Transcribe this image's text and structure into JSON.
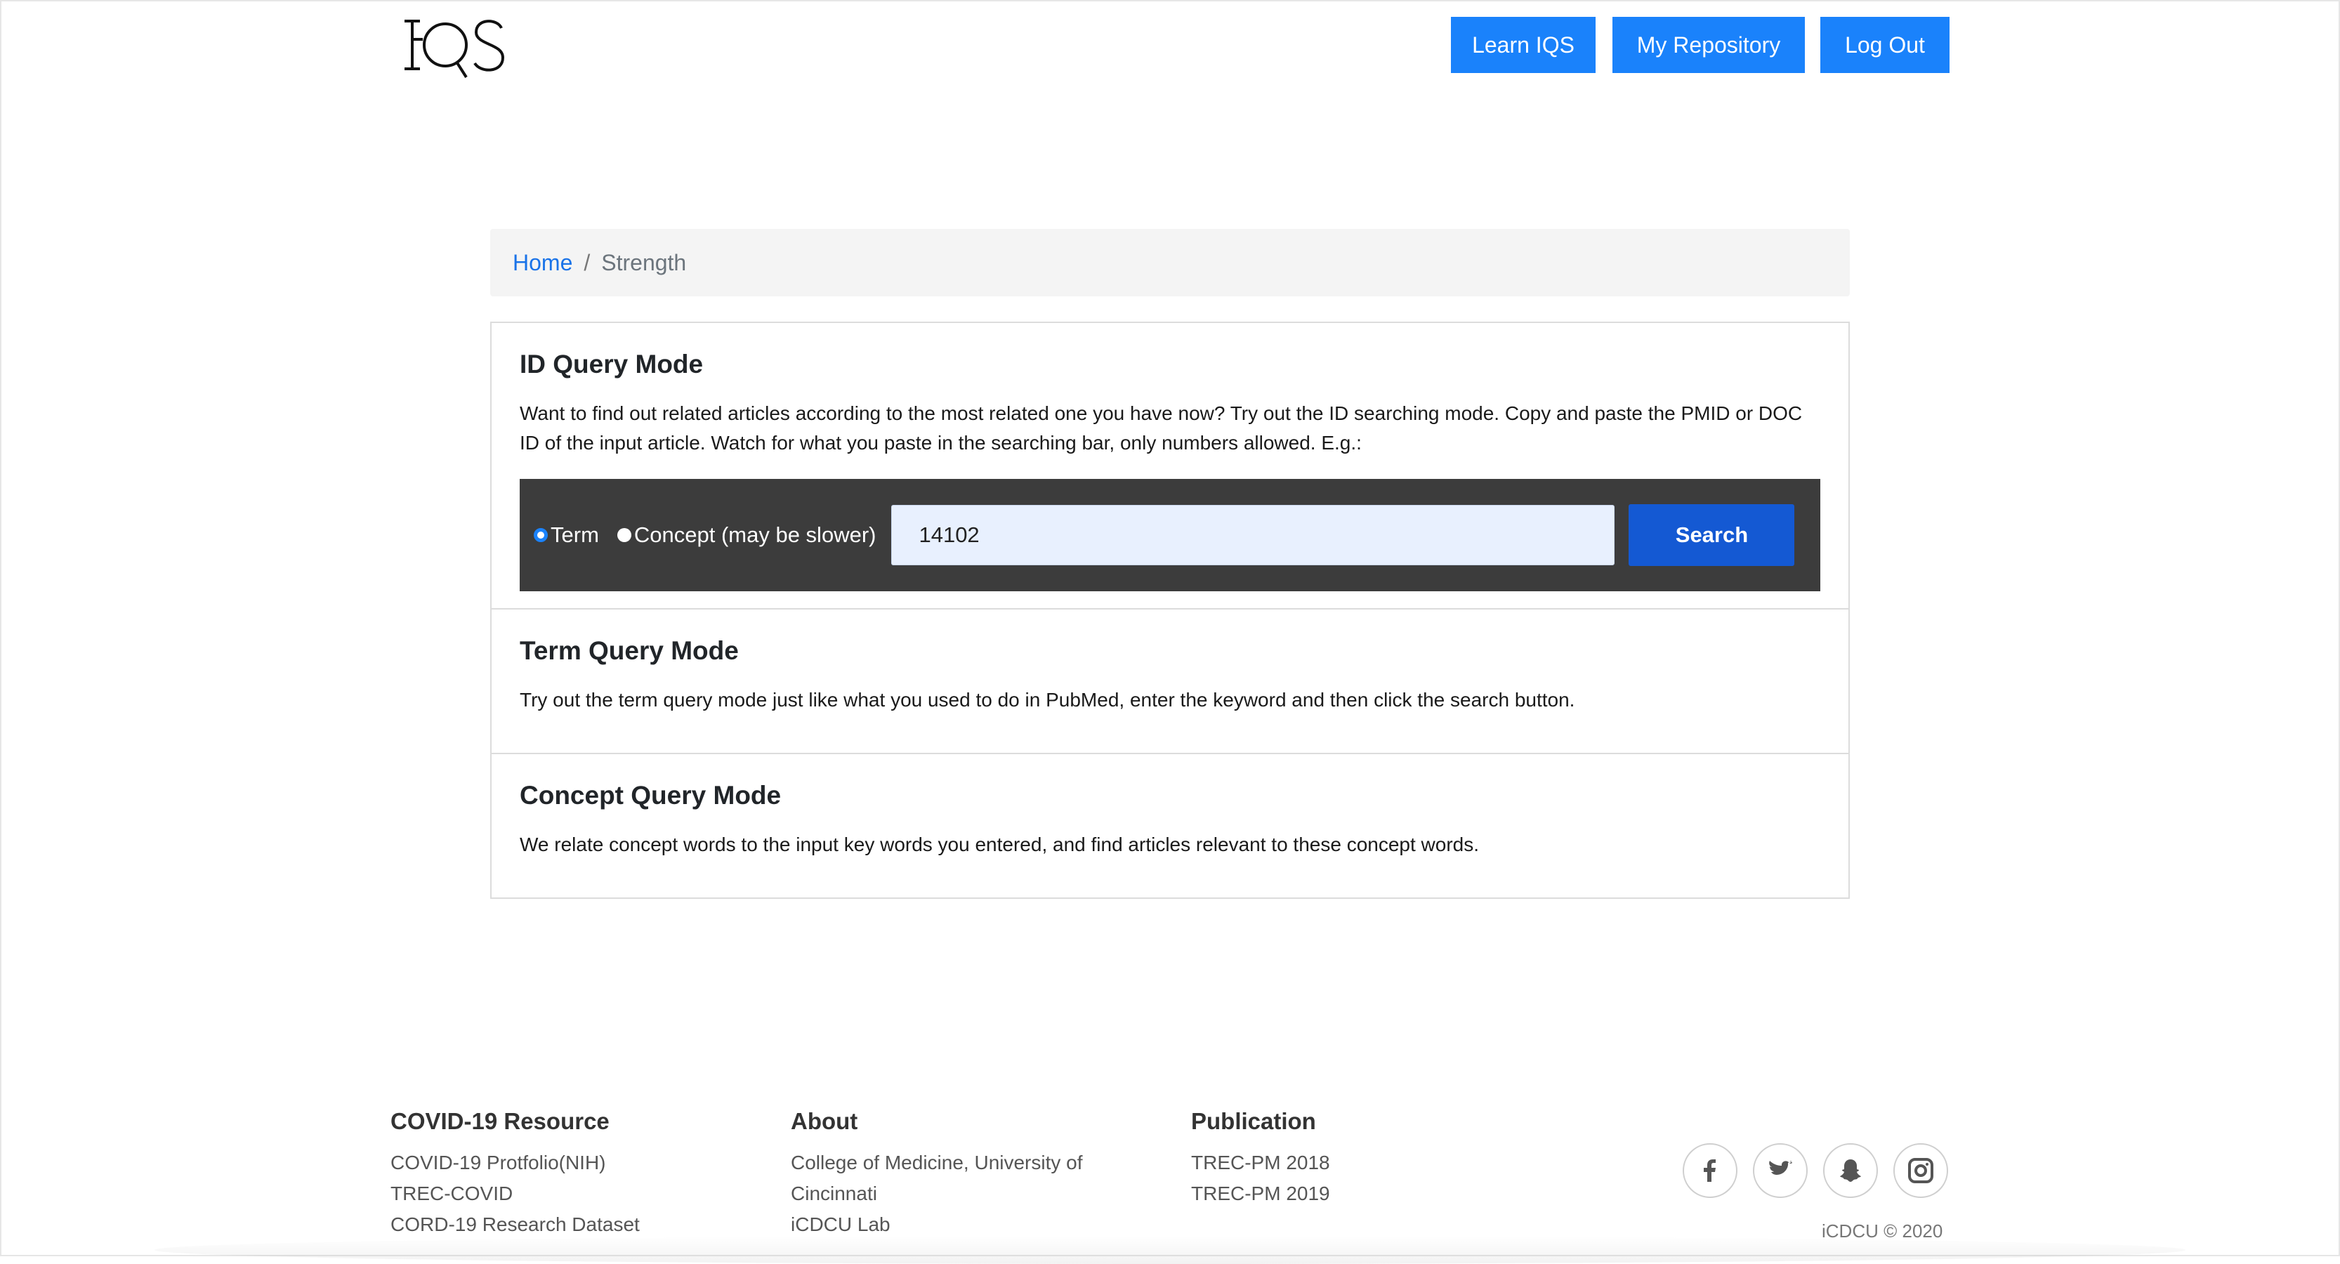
{
  "brand": {
    "logo_text": "IQS"
  },
  "nav": {
    "learn_label": "Learn IQS",
    "repo_label": "My Repository",
    "logout_label": "Log Out"
  },
  "breadcrumb": {
    "home": "Home",
    "separator": "/",
    "current": "Strength"
  },
  "id_mode": {
    "title": "ID Query Mode",
    "description": "Want to find out related articles according to the most related one you have now? Try out the ID searching mode. Copy and paste the PMID or DOC ID of the input article. Watch for what you paste in the searching bar, only numbers allowed. E.g.:",
    "radio_term": "Term",
    "radio_concept": "Concept (may be slower)",
    "selected_radio": "Term",
    "search_value": "14102",
    "search_button": "Search"
  },
  "term_mode": {
    "title": "Term Query Mode",
    "description": "Try out the term query mode just like what you used to do in PubMed, enter the keyword and then click the search button."
  },
  "concept_mode": {
    "title": "Concept Query Mode",
    "description": "We relate concept words to the input key words you entered, and find articles relevant to these concept words."
  },
  "footer": {
    "covid": {
      "title": "COVID-19 Resource",
      "links": [
        "COVID-19 Protfolio(NIH)",
        "TREC-COVID",
        "CORD-19 Research Dataset"
      ]
    },
    "about": {
      "title": "About",
      "links": [
        "College of Medicine, University of",
        "Cincinnati",
        "iCDCU Lab"
      ]
    },
    "publication": {
      "title": "Publication",
      "links": [
        "TREC-PM 2018",
        "TREC-PM 2019"
      ]
    },
    "social_icons": [
      "facebook-icon",
      "twitter-icon",
      "snapchat-icon",
      "instagram-icon"
    ],
    "copyright": "iCDCU © 2020"
  },
  "colors": {
    "primary": "#1a82fb",
    "search_button": "#1459d3",
    "search_bar_bg": "#3c3c3c",
    "input_bg": "#e8f0fe",
    "breadcrumb_bg": "#f4f4f4"
  }
}
